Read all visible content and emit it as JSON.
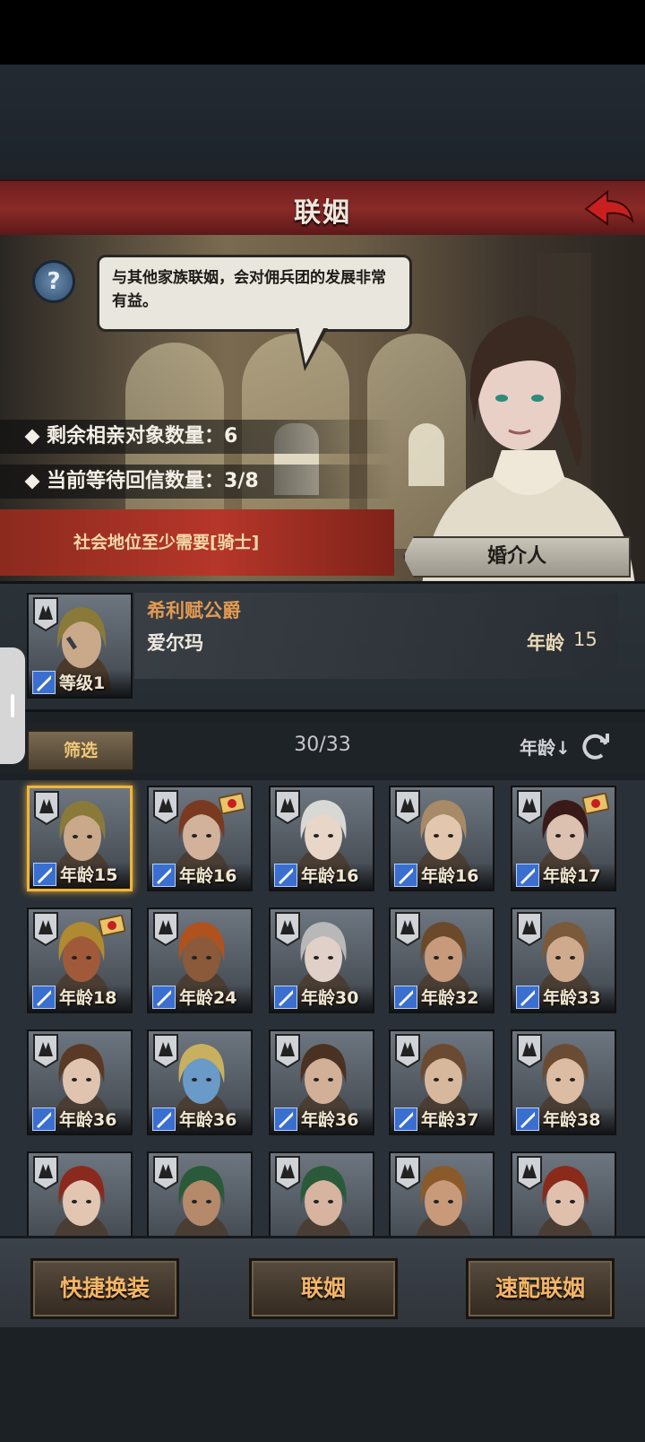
{
  "header": {
    "title": "联姻"
  },
  "scene": {
    "speech": "与其他家族联姻，会对佣兵团的发展非常有益。",
    "remaining_label": "剩余相亲对象数量：6",
    "waiting_label": "当前等待回信数量：3/8",
    "requirement": "社会地位至少需要[骑士]",
    "matchmaker_tag": "婚介人"
  },
  "selected": {
    "title": "希利赋公爵",
    "name": "爱尔玛",
    "level_label": "等级1",
    "age_label": "年龄",
    "age_value": "15"
  },
  "filter": {
    "filter_label": "筛选",
    "count": "30/33",
    "sort_label": "年龄↓"
  },
  "candidates": [
    {
      "age": "年龄15",
      "hair": "#8a7a3a",
      "skin": "#c9a98a",
      "seal": false
    },
    {
      "age": "年龄16",
      "hair": "#7a3a22",
      "skin": "#d2b29a",
      "seal": true
    },
    {
      "age": "年龄16",
      "hair": "#d8d8d4",
      "skin": "#e8d6c8",
      "seal": false
    },
    {
      "age": "年龄16",
      "hair": "#a88a66",
      "skin": "#e2c6ae",
      "seal": false
    },
    {
      "age": "年龄17",
      "hair": "#3a1a18",
      "skin": "#dcc0b0",
      "seal": true
    },
    {
      "age": "年龄18",
      "hair": "#b08a30",
      "skin": "#a05a3a",
      "seal": true
    },
    {
      "age": "年龄24",
      "hair": "#b0521e",
      "skin": "#8a5a3a",
      "seal": false
    },
    {
      "age": "年龄30",
      "hair": "#b8b8b8",
      "skin": "#e0d0c8",
      "seal": false
    },
    {
      "age": "年龄32",
      "hair": "#6a4a2a",
      "skin": "#c69a7a",
      "seal": false
    },
    {
      "age": "年龄33",
      "hair": "#7a5a3a",
      "skin": "#d0aa8c",
      "seal": false
    },
    {
      "age": "年龄36",
      "hair": "#5a3a26",
      "skin": "#e0c4b0",
      "seal": false
    },
    {
      "age": "年龄36",
      "hair": "#c8b060",
      "skin": "#6a9ac8",
      "seal": false
    },
    {
      "age": "年龄36",
      "hair": "#4a3222",
      "skin": "#d2b098",
      "seal": false
    },
    {
      "age": "年龄37",
      "hair": "#6a4a30",
      "skin": "#d8b89c",
      "seal": false
    },
    {
      "age": "年龄38",
      "hair": "#6a4c34",
      "skin": "#dcbca2",
      "seal": false
    },
    {
      "age": "",
      "hair": "#8a2a1e",
      "skin": "#e2c6b2",
      "seal": false
    },
    {
      "age": "",
      "hair": "#2a5a3a",
      "skin": "#b48a6a",
      "seal": false
    },
    {
      "age": "",
      "hair": "#2a5a3a",
      "skin": "#d6b4a0",
      "seal": false
    },
    {
      "age": "",
      "hair": "#8a5a2a",
      "skin": "#c89a7a",
      "seal": false
    },
    {
      "age": "",
      "hair": "#8a2a1a",
      "skin": "#e0c0ac",
      "seal": false
    }
  ],
  "actions": {
    "quick_outfit": "快捷换装",
    "marriage": "联姻",
    "quick_match": "速配联姻"
  },
  "colors": {
    "title_bar": "#8a2a27",
    "requirement_bg": "#b6362a",
    "accent_gold": "#f0b53c",
    "button_text": "#f5b566"
  }
}
